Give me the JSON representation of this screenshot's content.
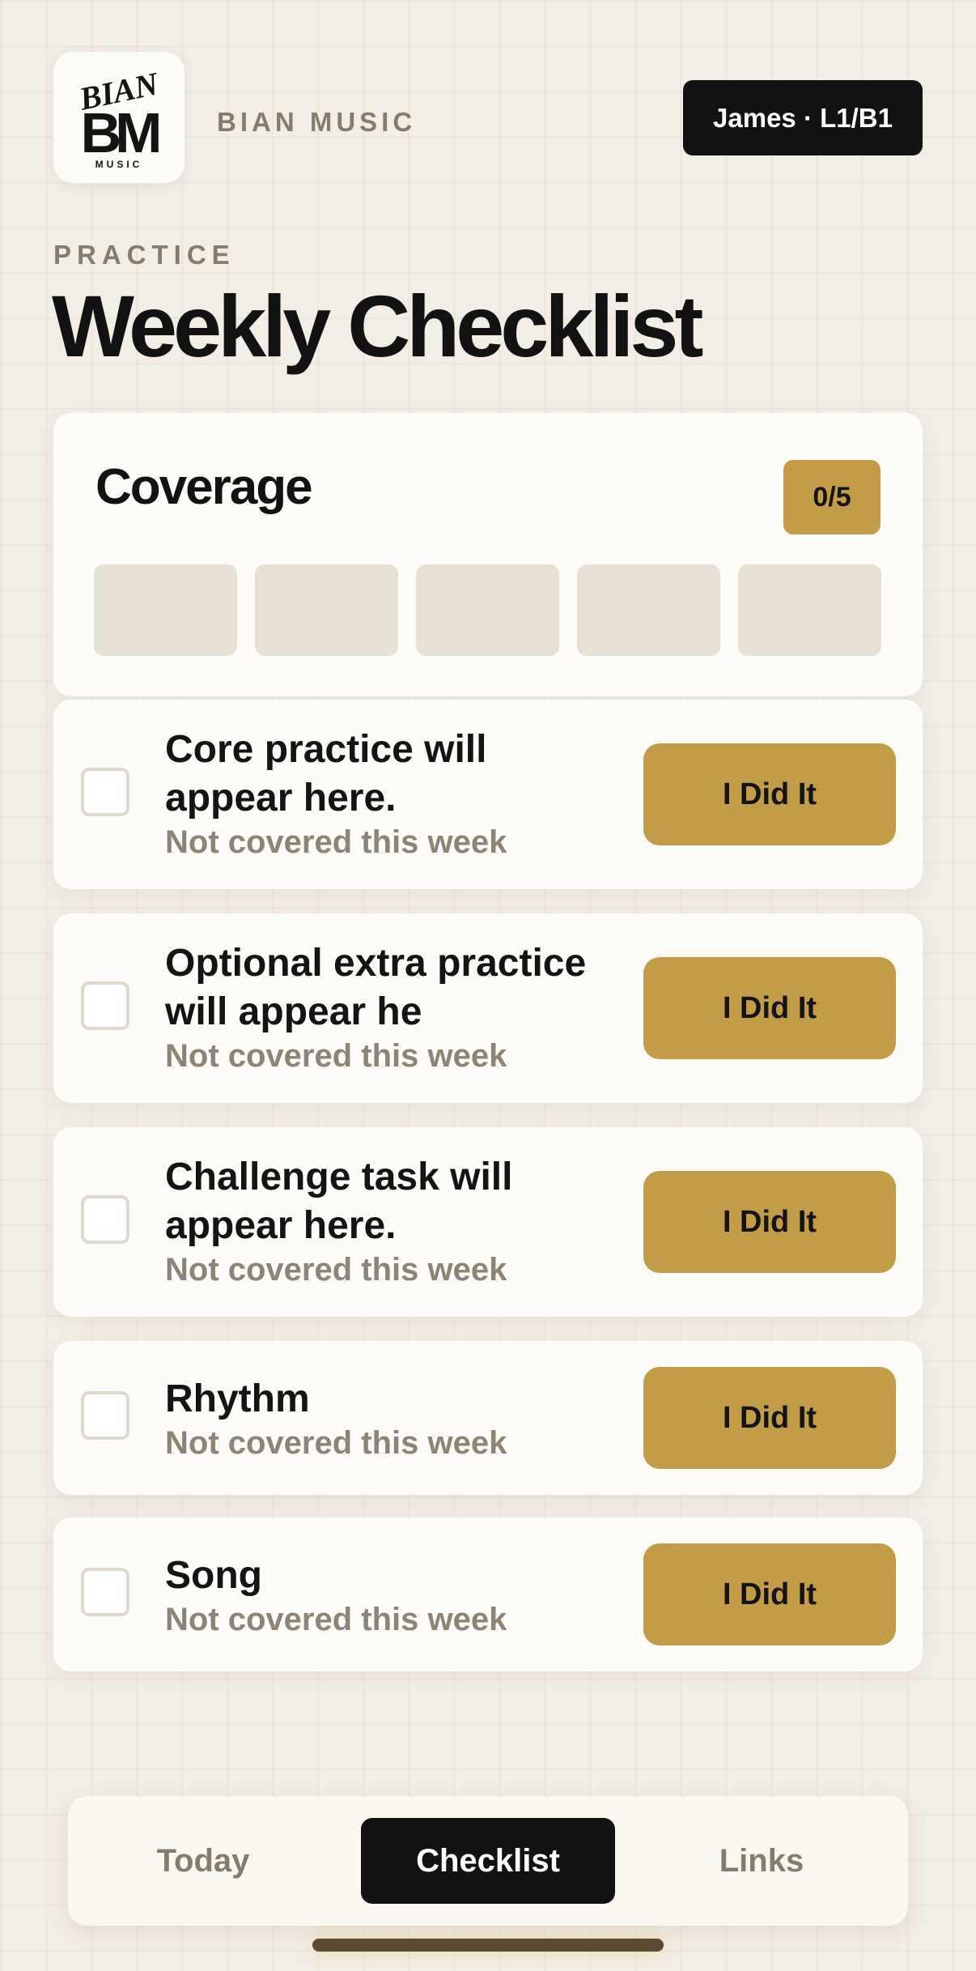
{
  "brand": {
    "logo_text_top": "BIAN",
    "logo_text_mid": "BM",
    "logo_text_bottom": "MUSIC",
    "name": "BIAN MUSIC"
  },
  "user": {
    "label": "James · L1/B1"
  },
  "page": {
    "eyebrow": "PRACTICE",
    "title": "Weekly Checklist"
  },
  "coverage": {
    "title": "Coverage",
    "count_label": "0/5",
    "completed": 0,
    "total": 5
  },
  "tasks": [
    {
      "label_line1": "Core practice will",
      "label_line2": "appear here.",
      "status": "Not covered this week",
      "button": "I Did It",
      "checked": false
    },
    {
      "label_line1": "Optional extra practice",
      "label_line2": "will appear he",
      "status": "Not covered this week",
      "button": "I Did It",
      "checked": false
    },
    {
      "label_line1": "Challenge task will",
      "label_line2": "appear here.",
      "status": "Not covered this week",
      "button": "I Did It",
      "checked": false
    },
    {
      "label_line1": "Rhythm",
      "status": "Not covered this week",
      "button": "I Did It",
      "checked": false
    },
    {
      "label_line1": "Song",
      "status": "Not covered this week",
      "button": "I Did It",
      "checked": false
    }
  ],
  "nav": {
    "items": [
      {
        "label": "Today",
        "active": false
      },
      {
        "label": "Checklist",
        "active": true
      },
      {
        "label": "Links",
        "active": false
      }
    ]
  },
  "colors": {
    "accent": "#c29c47",
    "background": "#f2ede5",
    "dark": "#121212",
    "muted_text": "#857c6e"
  }
}
